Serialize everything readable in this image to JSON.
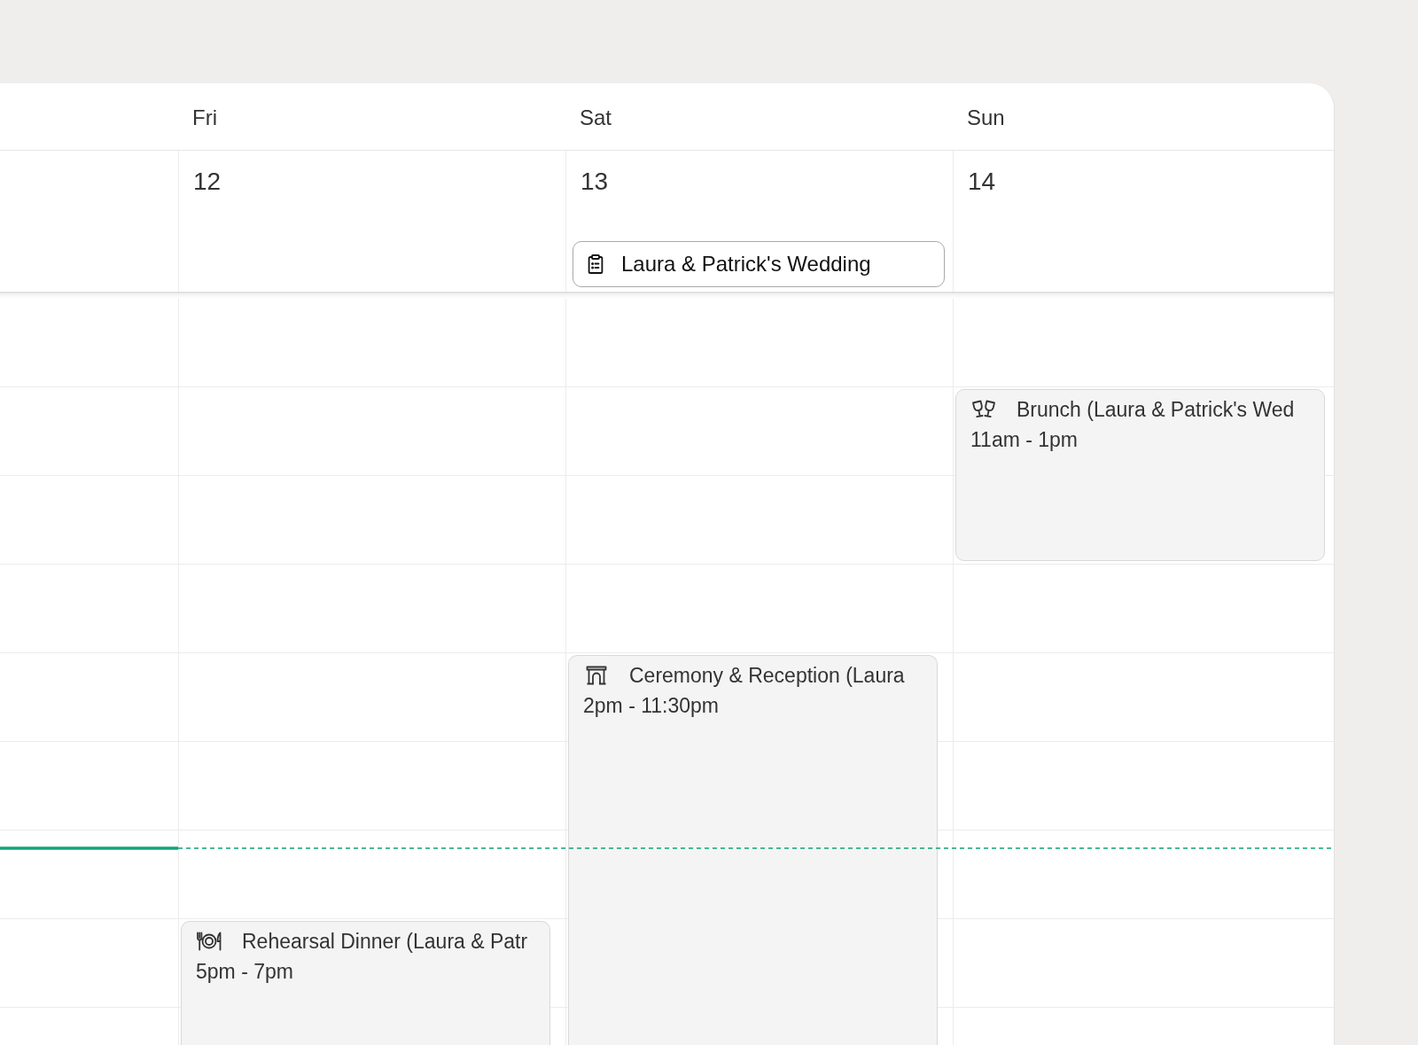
{
  "calendar": {
    "days": [
      {
        "name": "Fri",
        "date": "12",
        "events": [
          {
            "kind": "plate",
            "title": "Rehearsal Dinner (Laura & Patr",
            "time": "5pm - 7pm"
          }
        ]
      },
      {
        "name": "Sat",
        "date": "13",
        "all_day_events": [
          {
            "title": "Laura & Patrick's Wedding"
          }
        ],
        "events": [
          {
            "kind": "arch",
            "title": "Ceremony & Reception (Laura",
            "time": "2pm - 11:30pm"
          }
        ]
      },
      {
        "name": "Sun",
        "date": "14",
        "events": [
          {
            "kind": "glasses",
            "title": "Brunch (Laura & Patrick's Wed",
            "time": "11am - 1pm"
          }
        ]
      }
    ]
  }
}
